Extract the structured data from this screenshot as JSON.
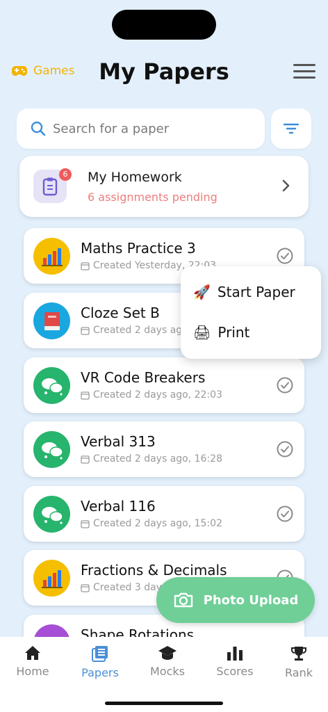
{
  "header": {
    "games_label": "Games",
    "games_icon": "gamepad-icon",
    "title": "My Papers",
    "menu_icon": "hamburger-menu-icon"
  },
  "search": {
    "placeholder": "Search for a paper",
    "value": "",
    "icon": "search-icon",
    "filter_icon": "filter-icon"
  },
  "homework": {
    "title": "My Homework",
    "subtitle": "6 assignments pending",
    "badge": "6",
    "icon": "clipboard-icon"
  },
  "papers": [
    {
      "title": "Maths Practice 3",
      "created": "Created Yesterday, 22:03",
      "avatar": "bar-chart-icon",
      "color": "#f5bf00"
    },
    {
      "title": "Cloze Set B",
      "created": "Created 2 days ag",
      "avatar": "book-icon",
      "color": "#1aa7e0"
    },
    {
      "title": "VR Code Breakers",
      "created": "Created 2 days ago, 22:03",
      "avatar": "speech-bubbles-icon",
      "color": "#27b46d"
    },
    {
      "title": "Verbal 313",
      "created": "Created 2 days ago, 16:28",
      "avatar": "speech-bubbles-icon",
      "color": "#27b46d"
    },
    {
      "title": "Verbal 116",
      "created": "Created 2 days ago, 15:02",
      "avatar": "speech-bubbles-icon",
      "color": "#27b46d"
    },
    {
      "title": "Fractions & Decimals",
      "created": "Created 3 day",
      "avatar": "bar-chart-icon",
      "color": "#f5bf00"
    },
    {
      "title": "Shape Rotations",
      "created": "",
      "avatar": "shapes-icon",
      "color": "#a64fd6"
    }
  ],
  "context_menu": {
    "items": [
      {
        "label": "Start Paper",
        "icon": "rocket-icon"
      },
      {
        "label": "Print",
        "icon": "printer-icon"
      }
    ]
  },
  "photo_upload": {
    "label": "Photo Upload",
    "icon": "camera-icon"
  },
  "bottom_nav": {
    "items": [
      {
        "label": "Home",
        "icon": "home-icon"
      },
      {
        "label": "Papers",
        "icon": "papers-icon"
      },
      {
        "label": "Mocks",
        "icon": "graduation-cap-icon"
      },
      {
        "label": "Scores",
        "icon": "bar-chart-icon"
      },
      {
        "label": "Rank",
        "icon": "trophy-icon"
      }
    ],
    "active": "Papers"
  },
  "colors": {
    "background": "#e3f0fc",
    "accent": "#4a8fd6",
    "games": "#f3b400",
    "pending": "#ef7d7d",
    "upload": "#6fcf97"
  }
}
